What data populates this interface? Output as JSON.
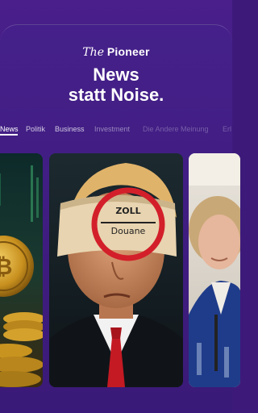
{
  "brand": {
    "the": "The",
    "name": "Pioneer"
  },
  "headline": {
    "line1": "News",
    "line2": "statt Noise."
  },
  "tabs": [
    {
      "label": "News"
    },
    {
      "label": "Politik"
    },
    {
      "label": "Business"
    },
    {
      "label": "Investment"
    },
    {
      "label": "Die Andere Meinung"
    },
    {
      "label": "Erl"
    }
  ],
  "thumbnails": {
    "center": {
      "sign_top": "ZOLL",
      "sign_bottom": "Douane"
    }
  },
  "colors": {
    "background": "#3d1a7a",
    "card": "#45208a",
    "text": "#ffffff"
  }
}
